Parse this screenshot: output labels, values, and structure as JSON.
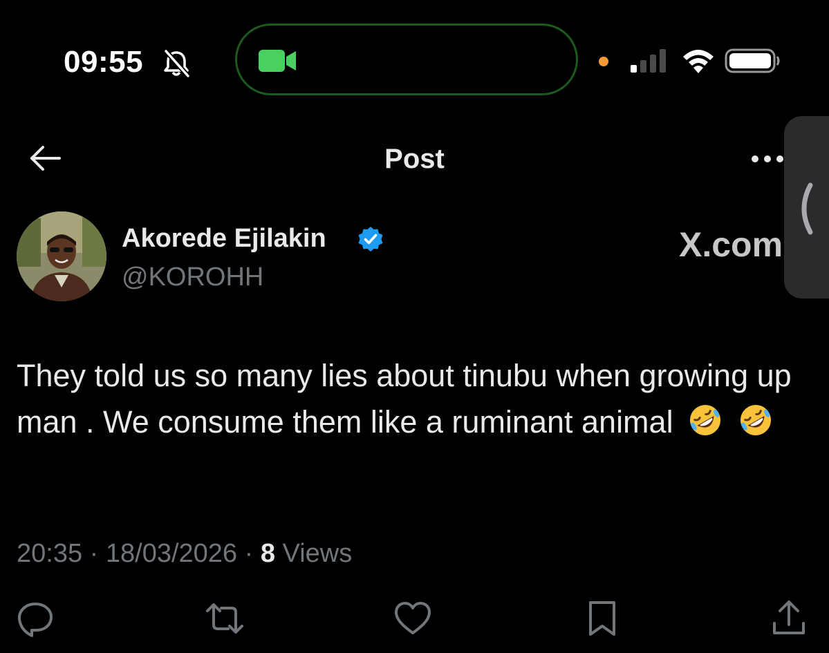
{
  "status_bar": {
    "time": "09:55",
    "icons": [
      "bell-slash-icon",
      "facetime-camera-icon",
      "privacy-dot-icon",
      "cellular-signal-icon",
      "wifi-icon",
      "battery-icon"
    ],
    "colors": {
      "camera": "#48d160",
      "privacy_dot": "#f29b38",
      "island_border": "#1d5a1e"
    }
  },
  "header": {
    "title": "Post",
    "back_icon": "arrow-left-icon",
    "more_icon": "more-horizontal-icon"
  },
  "post": {
    "author": {
      "name": "Akorede Ejilakin",
      "handle": "@KOROHH",
      "verified": true,
      "verified_color": "#1d9bf0"
    },
    "brand": "X.com",
    "text": "They told us so many lies about tinubu when growing up man . We consume them like a ruminant animal",
    "emojis": [
      "rolling-on-floor-laughing-emoji",
      "rolling-on-floor-laughing-emoji"
    ],
    "time": "20:35",
    "date": "18/03/2026",
    "separator": "·",
    "views_count": "8",
    "views_label": "Views"
  },
  "actions": [
    {
      "name": "reply",
      "icon": "reply-icon"
    },
    {
      "name": "repost",
      "icon": "repost-icon"
    },
    {
      "name": "like",
      "icon": "heart-icon"
    },
    {
      "name": "bookmark",
      "icon": "bookmark-icon"
    },
    {
      "name": "share",
      "icon": "share-icon"
    }
  ],
  "colors": {
    "background": "#000000",
    "primary_text": "#e7e9ea",
    "secondary_text": "#71767b"
  }
}
